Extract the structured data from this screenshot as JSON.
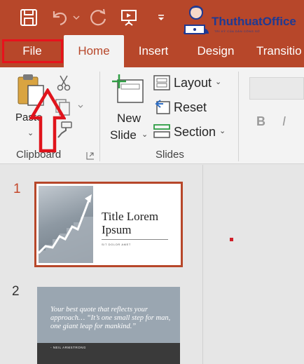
{
  "logo": {
    "name": "ThuthuatOffice",
    "tagline": "TRI KỶ CỦA DÂN CÔNG SỞ"
  },
  "tabs": [
    {
      "label": "File"
    },
    {
      "label": "Home"
    },
    {
      "label": "Insert"
    },
    {
      "label": "Design"
    },
    {
      "label": "Transitio"
    }
  ],
  "ribbon": {
    "clipboard": {
      "paste_label": "Paste",
      "group_label": "Clipboard"
    },
    "slides": {
      "new_slide_line1": "New",
      "new_slide_line2": "Slide",
      "layout_label": "Layout",
      "reset_label": "Reset",
      "section_label": "Section",
      "group_label": "Slides"
    },
    "font": {
      "bold_label": "B",
      "italic_label": "I"
    }
  },
  "thumbnails": [
    {
      "number": "1",
      "title": "Title Lorem Ipsum",
      "subtitle": "SIT DOLOR AMET"
    },
    {
      "number": "2",
      "quote": "Your best quote that reflects your approach… “It’s one small step for man, one giant leap for mankind.”",
      "author": "- NEIL ARMSTRONG"
    }
  ],
  "colors": {
    "accent": "#b7472a",
    "highlight_box": "#e8121c",
    "selected_slide_number": "#c4472a"
  },
  "icons": [
    "save-icon",
    "undo-icon",
    "redo-icon",
    "present-icon",
    "customize-qat-icon",
    "paste-icon",
    "cut-icon",
    "copy-icon",
    "format-painter-icon",
    "new-slide-icon",
    "layout-icon",
    "reset-icon",
    "section-icon",
    "dialog-launcher-icon",
    "arrow-up-annotation"
  ]
}
